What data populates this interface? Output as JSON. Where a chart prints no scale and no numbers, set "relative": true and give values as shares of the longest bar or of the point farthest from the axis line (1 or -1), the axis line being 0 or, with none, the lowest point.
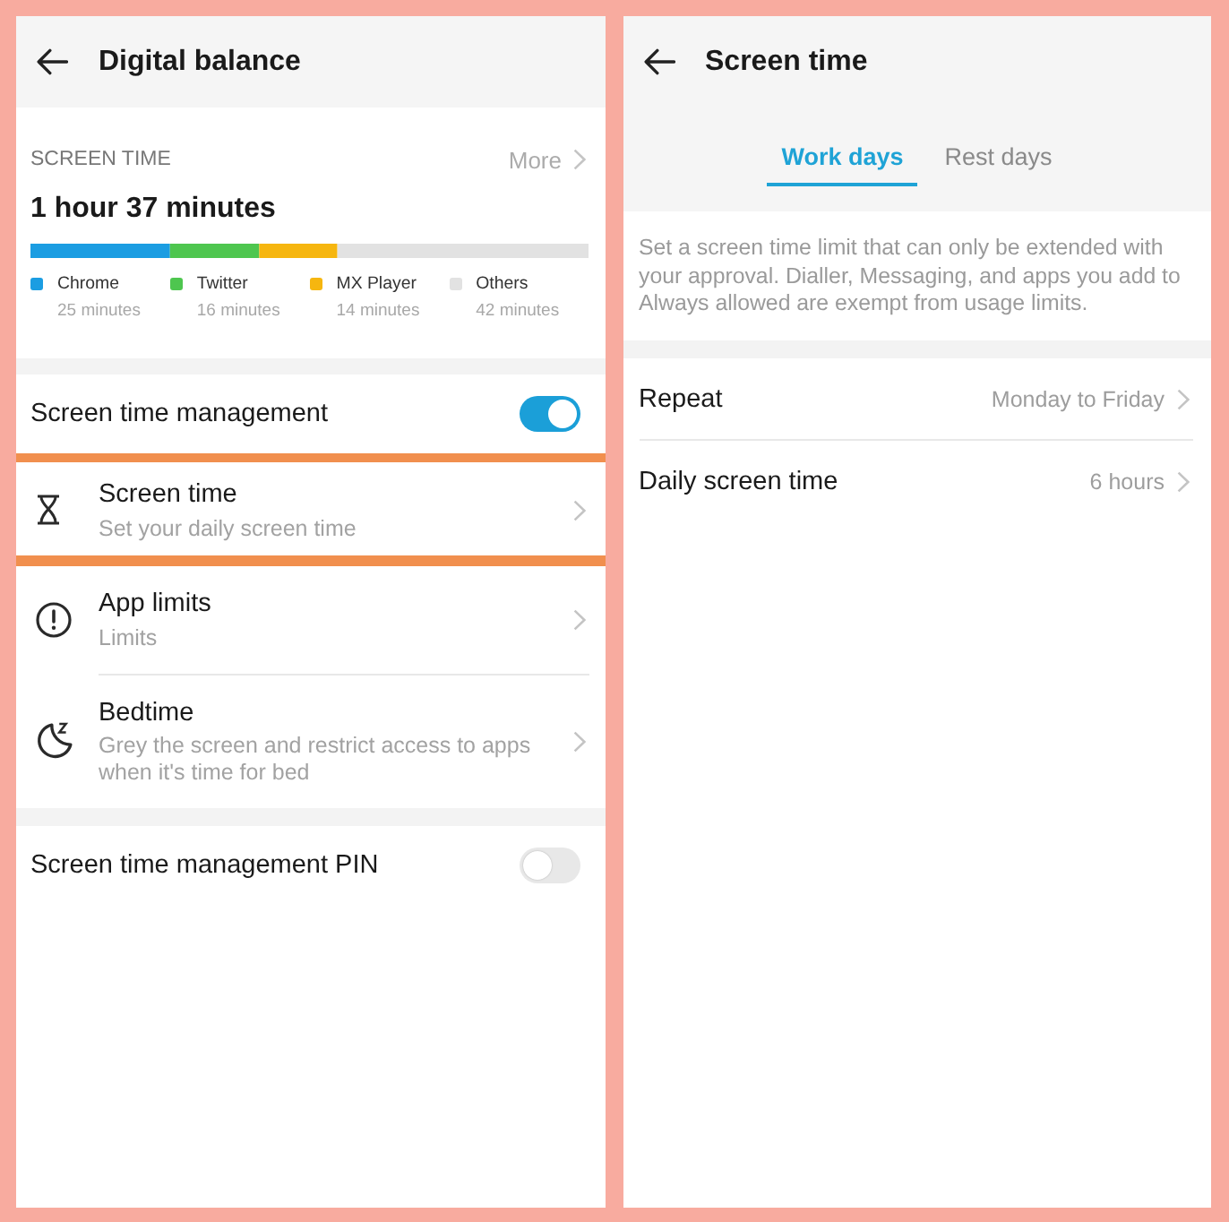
{
  "digital_balance": {
    "title": "Digital balance",
    "usage": {
      "heading": "SCREEN TIME",
      "more": "More",
      "total": "1 hour 37 minutes",
      "chart_data": {
        "type": "bar",
        "orientation": "horizontal",
        "stacked": true,
        "relative": true,
        "legend": "bottom",
        "series": [
          {
            "name": "Chrome",
            "color": "#1b9de2",
            "values": [
              0.25
            ]
          },
          {
            "name": "Twitter",
            "color": "#4ec64f",
            "values": [
              0.16
            ]
          },
          {
            "name": "MX Player",
            "color": "#f6b60f",
            "values": [
              0.14
            ]
          },
          {
            "name": "Others",
            "color": "#e2e2e2",
            "values": [
              0.45
            ]
          }
        ],
        "value_labels": [
          "25 minutes",
          "16 minutes",
          "14 minutes",
          "42 minutes"
        ]
      }
    },
    "sections": [
      {
        "rows": [
          {
            "kind": "toggle",
            "label": "Screen time management",
            "on": true
          },
          {
            "kind": "link",
            "label": "Screen time",
            "subtitle": "Set your daily screen time",
            "highlighted": true
          },
          {
            "kind": "link",
            "label": "App limits",
            "subtitle": "Limits",
            "highlighted": false
          },
          {
            "kind": "link",
            "label": "Bedtime",
            "subtitle": "Grey the screen and restrict access to apps when it's time for bed",
            "highlighted": false
          }
        ]
      },
      {
        "rows": [
          {
            "kind": "toggle",
            "label": "Screen time management PIN",
            "on": false
          }
        ]
      }
    ]
  },
  "screen_time": {
    "title": "Screen time",
    "tabs": [
      {
        "label": "Work days",
        "selected": true
      },
      {
        "label": "Rest days",
        "selected": false
      }
    ],
    "description": "Set a screen time limit that can only be extended with your approval. Dialler, Messaging, and apps you add to Always allowed are exempt from usage limits.",
    "rows": [
      {
        "label": "Repeat",
        "value": "Monday to Friday"
      },
      {
        "label": "Daily screen time",
        "value": "6 hours"
      }
    ]
  }
}
